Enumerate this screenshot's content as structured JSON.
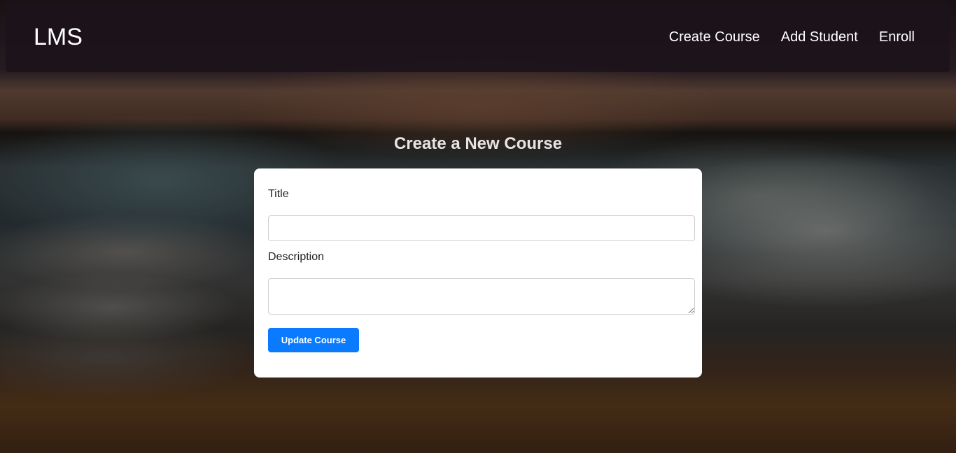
{
  "navbar": {
    "brand": "LMS",
    "links": [
      {
        "label": "Create Course"
      },
      {
        "label": "Add Student"
      },
      {
        "label": "Enroll"
      }
    ]
  },
  "page": {
    "title": "Create a New Course"
  },
  "form": {
    "title_label": "Title",
    "title_value": "",
    "title_placeholder": "",
    "description_label": "Description",
    "description_value": "",
    "description_placeholder": "",
    "submit_label": "Update Course"
  },
  "colors": {
    "navbar_bg": "#1c121a",
    "primary_button": "#0a7bff",
    "card_bg": "#ffffff"
  }
}
